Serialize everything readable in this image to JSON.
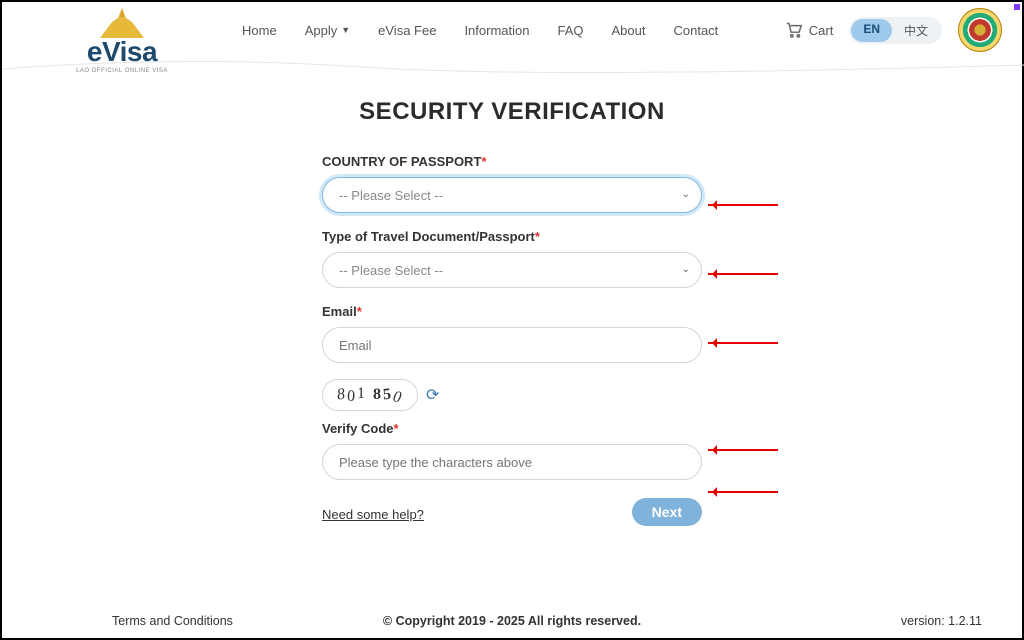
{
  "brand": {
    "name": "eVisa",
    "sub": "LAO OFFICIAL ONLINE VISA"
  },
  "nav": {
    "home": "Home",
    "apply": "Apply",
    "fee": "eVisa Fee",
    "info": "Information",
    "faq": "FAQ",
    "about": "About",
    "contact": "Contact"
  },
  "cart": {
    "label": "Cart"
  },
  "lang": {
    "en": "EN",
    "zh": "中文"
  },
  "page": {
    "title": "SECURITY VERIFICATION",
    "fields": {
      "country_label": "COUNTRY OF PASSPORT",
      "country_placeholder": "-- Please Select --",
      "doc_label": "Type of Travel Document/Passport",
      "doc_placeholder": "-- Please Select --",
      "email_label": "Email",
      "email_placeholder": "Email",
      "verify_label": "Verify Code",
      "verify_placeholder": "Please type the characters above"
    },
    "captcha": [
      "8",
      "0",
      "1",
      "8",
      "5",
      "0"
    ],
    "help": "Need some help?",
    "next": "Next"
  },
  "footer": {
    "terms": "Terms and Conditions",
    "copyright": "© Copyright 2019 - 2025 All rights reserved.",
    "version": "version: 1.2.11"
  }
}
